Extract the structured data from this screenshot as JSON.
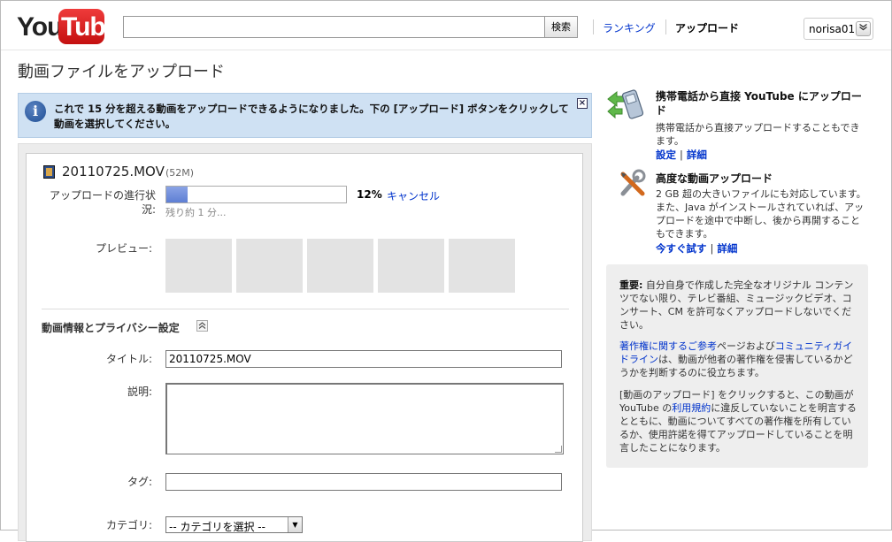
{
  "header": {
    "logo_you": "You",
    "logo_tube": "Tube",
    "search_placeholder": "",
    "search_button": "検索",
    "nav_ranking": "ランキング",
    "nav_upload": "アップロード",
    "user_name": "norisa01"
  },
  "page_title": "動画ファイルをアップロード",
  "notice": {
    "text": "これで 15 分を超える動画をアップロードできるようになりました。下の [アップロード] ボタンをクリックして動画を選択してください。",
    "close": "×"
  },
  "upload": {
    "file_name": "20110725.MOV",
    "file_size": "(52M)",
    "progress_label": "アップロードの進行状況:",
    "progress_percent": "12%",
    "progress_value": 0.12,
    "cancel_label": "キャンセル",
    "remaining_text": "残り約 1 分...",
    "preview_label": "プレビュー:",
    "section_title": "動画情報とプライバシー設定",
    "title_label": "タイトル:",
    "title_value": "20110725.MOV",
    "description_label": "説明:",
    "tags_label": "タグ:",
    "category_label": "カテゴリ:",
    "category_value": "-- カテゴリを選択 --"
  },
  "sidebar": {
    "mobile": {
      "title": "携帯電話から直接 YouTube にアップロード",
      "text": "携帯電話から直接アップロードすることもできます。",
      "link_settings": "設定",
      "link_details": "詳細",
      "separator": "|"
    },
    "advanced": {
      "title": "高度な動画アップロード",
      "text": "2 GB 超の大きいファイルにも対応しています。また、Java がインストールされていれば、アップロードを途中で中断し、後から再開することもできます。",
      "link_try": "今すぐ試す",
      "link_details": "詳細",
      "separator": "|"
    },
    "important": {
      "p1_bold": "重要:",
      "p1_text": " 自分自身で作成した完全なオリジナル コンテンツでない限り、テレビ番組、ミュージックビデオ、コンサート、CM を許可なくアップロードしないでください。",
      "p2_link1": "著作権に関するご参考",
      "p2_mid": "ページおよび",
      "p2_link2": "コミュニティガイドライン",
      "p2_end": "は、動画が他者の著作権を侵害しているかどうかを判断するのに役立ちます。",
      "p3_start": "[動画のアップロード] をクリックすると、この動画が YouTube の",
      "p3_link": "利用規約",
      "p3_end": "に違反していないことを明言するとともに、動画についてすべての著作権を所有しているか、使用許諾を得てアップロードしていることを明言したことになります。"
    }
  }
}
